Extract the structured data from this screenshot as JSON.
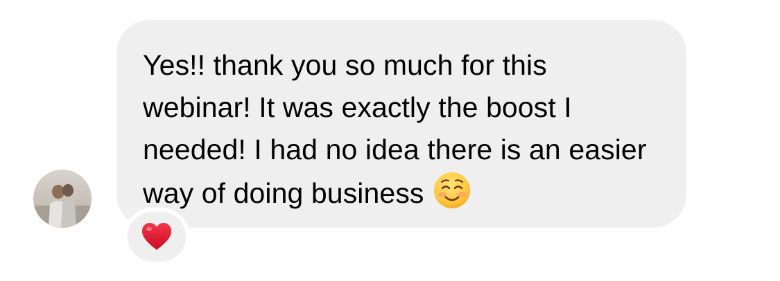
{
  "conversation": {
    "sender": {
      "avatar_icon": "profile-photo-avatar"
    },
    "message": {
      "text": "Yes!! thank you so much for this webinar! It was exactly the boost I needed! I had no idea there is an easier way of doing business",
      "trailing_emoji": "smiling-face-with-rosy-cheeks",
      "bubble_color": "#efefef",
      "text_color": "#000000"
    },
    "reaction": {
      "emoji": "red-heart",
      "color": "#e0142b"
    }
  }
}
